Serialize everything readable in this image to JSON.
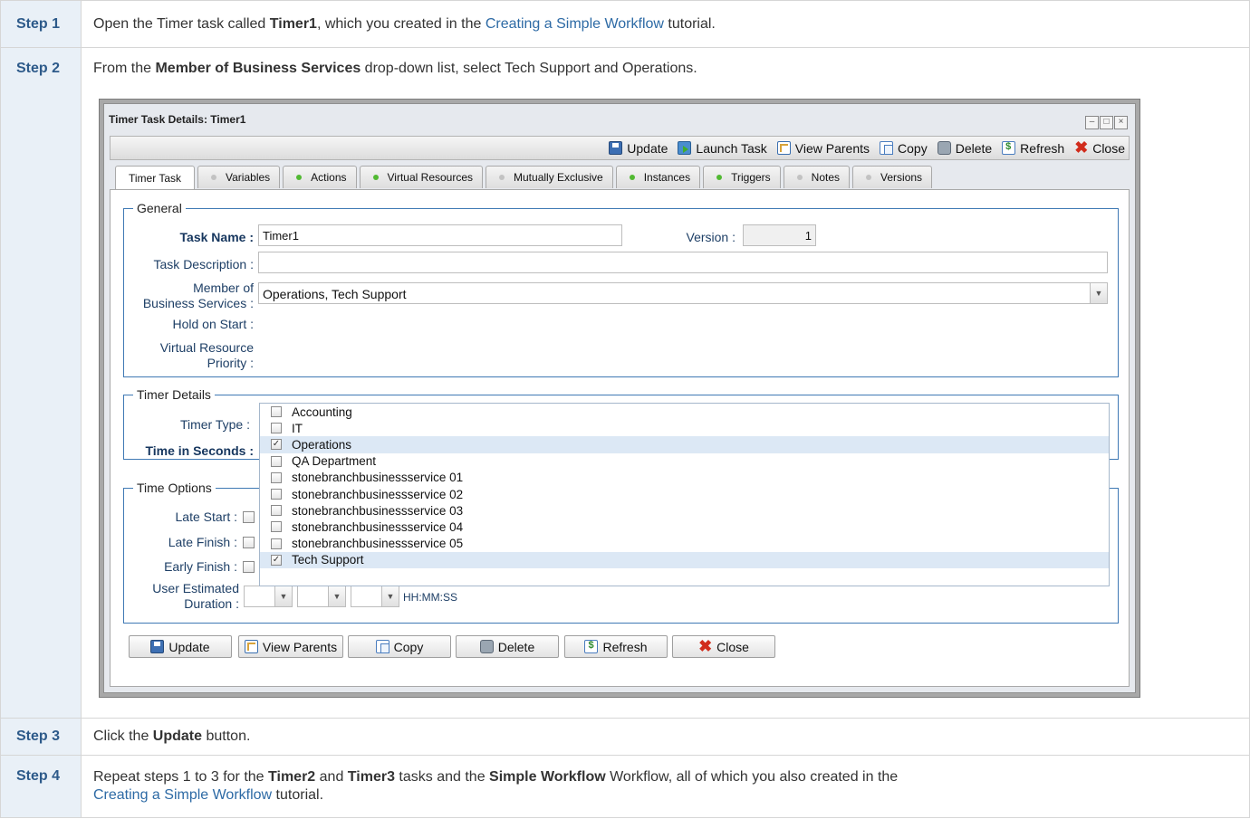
{
  "steps": [
    {
      "label": "Step 1",
      "pre": "Open the Timer task called ",
      "bold1": "Timer1",
      "mid": ", which you created in the ",
      "link": "Creating a Simple Workflow",
      "post": " tutorial."
    },
    {
      "label": "Step 2",
      "pre": "From the ",
      "bold1": "Member of Business Services",
      "post": " drop-down list, select Tech Support and Operations."
    },
    {
      "label": "Step 3",
      "pre": "Click the ",
      "bold1": "Update",
      "post": " button."
    },
    {
      "label": "Step 4",
      "pre": "Repeat steps 1 to 3 for the ",
      "bold1": "Timer2",
      "and": " and ",
      "bold2": "Timer3",
      "mid": " tasks and the ",
      "bold3": "Simple Workflow",
      "post": " Workflow, all of which you also created in the",
      "link": "Creating a Simple Workflow",
      "post2": " tutorial."
    }
  ],
  "window": {
    "title": "Timer Task Details: Timer1",
    "controls": [
      "–",
      "□",
      "×"
    ],
    "toolbar": [
      {
        "label": "Update",
        "icon": "save-icon"
      },
      {
        "label": "Launch Task",
        "icon": "launch-icon"
      },
      {
        "label": "View Parents",
        "icon": "parents-icon"
      },
      {
        "label": "Copy",
        "icon": "copy-icon"
      },
      {
        "label": "Delete",
        "icon": "delete-icon"
      },
      {
        "label": "Refresh",
        "icon": "refresh-icon"
      },
      {
        "label": "Close",
        "icon": "close-icon"
      }
    ],
    "tabs": [
      {
        "label": "Timer Task",
        "dot": "none",
        "active": true
      },
      {
        "label": "Variables",
        "dot": "gray"
      },
      {
        "label": "Actions",
        "dot": "green"
      },
      {
        "label": "Virtual Resources",
        "dot": "green"
      },
      {
        "label": "Mutually Exclusive",
        "dot": "gray"
      },
      {
        "label": "Instances",
        "dot": "green"
      },
      {
        "label": "Triggers",
        "dot": "green"
      },
      {
        "label": "Notes",
        "dot": "gray"
      },
      {
        "label": "Versions",
        "dot": "gray"
      }
    ],
    "general": {
      "legend": "General",
      "task_name_label": "Task Name :",
      "task_name": "Timer1",
      "version_label": "Version :",
      "version": "1",
      "task_desc_label": "Task Description :",
      "task_desc": "",
      "member_label1": "Member of",
      "member_label2": "Business Services :",
      "member_value": "Operations, Tech Support",
      "hold_label": "Hold on Start :",
      "vr_label1": "Virtual Resource",
      "vr_label2": "Priority :"
    },
    "dropdown_options": [
      {
        "label": "Accounting",
        "checked": false
      },
      {
        "label": "IT",
        "checked": false
      },
      {
        "label": "Operations",
        "checked": true
      },
      {
        "label": "QA Department",
        "checked": false
      },
      {
        "label": "stonebranchbusinessservice 01",
        "checked": false
      },
      {
        "label": "stonebranchbusinessservice 02",
        "checked": false
      },
      {
        "label": "stonebranchbusinessservice 03",
        "checked": false
      },
      {
        "label": "stonebranchbusinessservice 04",
        "checked": false
      },
      {
        "label": "stonebranchbusinessservice 05",
        "checked": false
      },
      {
        "label": "Tech Support",
        "checked": true
      }
    ],
    "timer_details": {
      "legend": "Timer Details",
      "timer_type_label": "Timer Type :",
      "time_seconds_label": "Time in Seconds :"
    },
    "time_options": {
      "legend": "Time Options",
      "late_start_label": "Late Start :",
      "late_finish_label": "Late Finish :",
      "early_finish_label": "Early Finish :",
      "user_est_label1": "User Estimated",
      "user_est_label2": "Duration :",
      "hms": "HH:MM:SS"
    },
    "bottom_buttons": [
      {
        "label": "Update",
        "icon": "save-icon"
      },
      {
        "label": "View Parents",
        "icon": "parents-icon"
      },
      {
        "label": "Copy",
        "icon": "copy-icon"
      },
      {
        "label": "Delete",
        "icon": "delete-icon"
      },
      {
        "label": "Refresh",
        "icon": "refresh-icon"
      },
      {
        "label": "Close",
        "icon": "close-icon"
      }
    ]
  }
}
